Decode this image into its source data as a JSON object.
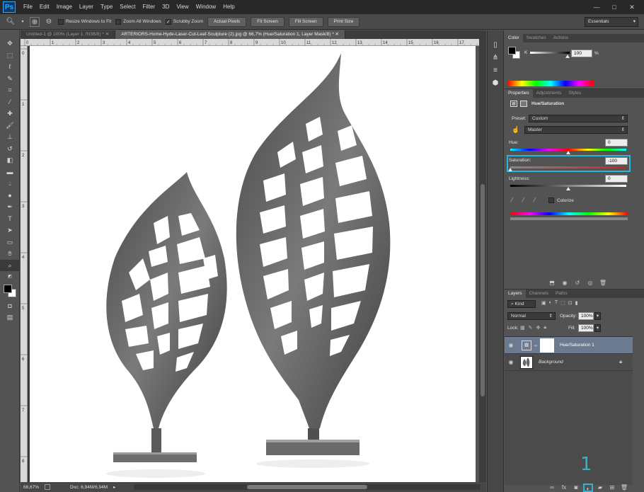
{
  "app": {
    "logo": "Ps"
  },
  "menubar": {
    "items": [
      "File",
      "Edit",
      "Image",
      "Layer",
      "Type",
      "Select",
      "Filter",
      "3D",
      "View",
      "Window",
      "Help"
    ],
    "window_controls": [
      "—",
      "□",
      "✕"
    ]
  },
  "options": {
    "resize_windows": "Resize Windows to Fit",
    "zoom_all_windows": "Zoom All Windows",
    "scrubby_zoom": "Scrubby Zoom",
    "buttons": [
      "Actual Pixels",
      "Fit Screen",
      "Fill Screen",
      "Print Size"
    ],
    "workspace": "Essentials"
  },
  "document": {
    "tabs": [
      "Untitled-1 @ 100% (Layer 1, RGB/8) *  ✕",
      "ARTERIORS-Home-Hyde-Laser-Cut-Leaf-Sculpture (2).jpg @ 66,7% (Hue/Saturation 1, Layer Mask/8) *  ✕"
    ],
    "status_zoom": "66,67%",
    "status_doc": "Doc: 6,94M/6,94M",
    "ruler_top": [
      "0",
      "1",
      "2",
      "3",
      "4",
      "5",
      "6",
      "7",
      "8",
      "9",
      "10",
      "11",
      "12",
      "13",
      "14",
      "15",
      "16",
      "17"
    ],
    "ruler_left": [
      "0",
      "1",
      "2",
      "3",
      "4",
      "5",
      "6",
      "7",
      "8"
    ]
  },
  "color_panel": {
    "tabs": [
      "Color",
      "Swatches",
      "Actions"
    ],
    "channel_label": "K",
    "value": "100",
    "unit": "%"
  },
  "properties_panel": {
    "tabs": [
      "Properties",
      "Adjustments",
      "Styles"
    ],
    "title": "Hue/Saturation",
    "preset_label": "Preset:",
    "preset_value": "Custom",
    "range_value": "Master",
    "hue_label": "Hue:",
    "hue_value": "0",
    "saturation_label": "Saturation:",
    "saturation_value": "-100",
    "lightness_label": "Lightness:",
    "lightness_value": "0",
    "colorize_label": "Colorize",
    "saturation_level": -100,
    "highlight_color": "#29b6d8"
  },
  "layers_panel": {
    "tabs": [
      "Layers",
      "Channels",
      "Paths"
    ],
    "filter_kind": "Kind",
    "blend_mode": "Normal",
    "opacity_label": "Opacity:",
    "opacity_value": "100%",
    "lock_label": "Lock:",
    "fill_label": "Fill:",
    "fill_value": "100%",
    "layers": [
      {
        "name": "Hue/Saturation 1",
        "selected": true
      },
      {
        "name": "Background",
        "selected": false
      }
    ]
  },
  "annotation": {
    "number": "1",
    "color": "#29b6d8"
  }
}
